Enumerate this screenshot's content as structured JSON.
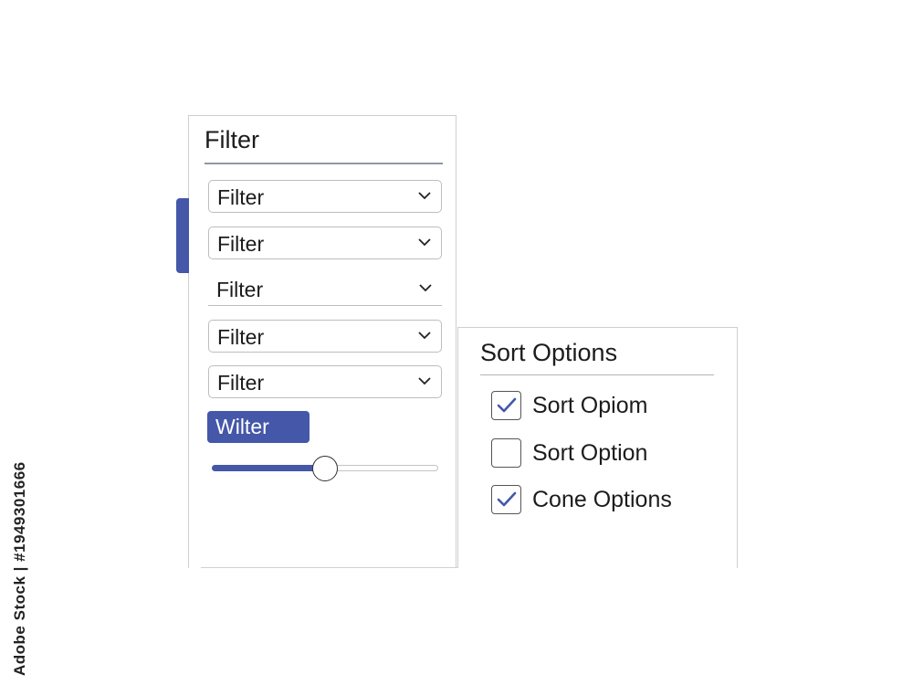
{
  "filter_panel": {
    "title": "Filter",
    "dropdowns": [
      {
        "label": "Filter",
        "style": "boxed"
      },
      {
        "label": "Filter",
        "style": "boxed"
      },
      {
        "label": "Filter",
        "style": "underline"
      },
      {
        "label": "Filter",
        "style": "boxed"
      },
      {
        "label": "Filter",
        "style": "boxed"
      }
    ],
    "button_label": "Wilter",
    "slider_value": 0.5
  },
  "sort_panel": {
    "title": "Sort Options",
    "options": [
      {
        "label": "Sort Opiom",
        "checked": true
      },
      {
        "label": "Sort Option",
        "checked": false
      },
      {
        "label": "Cone Options",
        "checked": true
      }
    ]
  },
  "watermark": "Adobe Stock | #1949301666",
  "colors": {
    "accent": "#4457a8",
    "border": "#cfcfcf",
    "text": "#1c1c1c"
  },
  "icons": {
    "dropdown": "chevron-down-icon",
    "checkbox": "checkmark-icon"
  }
}
